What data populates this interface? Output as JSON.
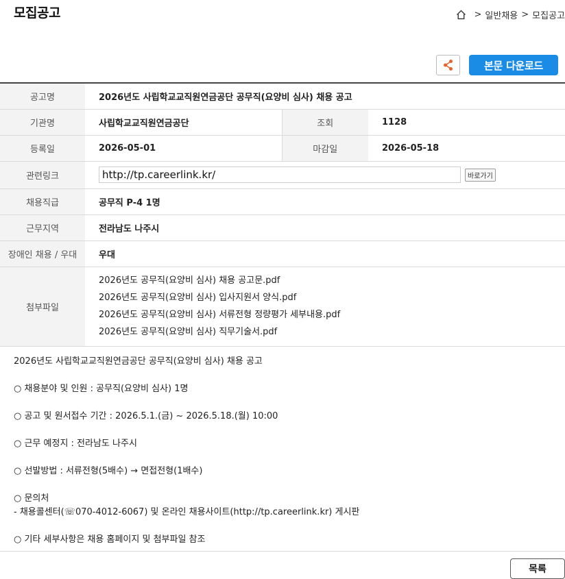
{
  "header": {
    "title": "모집공고",
    "breadcrumb": [
      ">",
      "일반채용",
      ">",
      "모집공고"
    ]
  },
  "actions": {
    "share_icon": "share-icon",
    "download_label": "본문 다운로드",
    "accent_color": "#1a8ce6"
  },
  "info": {
    "title_label": "공고명",
    "title_value": "2026년도 사립학교교직원연금공단 공무직(요양비 심사) 채용 공고",
    "org_label": "기관명",
    "org_value": "사립학교교직원연금공단",
    "views_label": "조회",
    "views_value": "1128",
    "reg_label": "등록일",
    "reg_value": "2026-05-01",
    "deadline_label": "마감일",
    "deadline_value": "2026-05-18",
    "link_label": "관련링크",
    "link_value": "http://tp.careerlink.kr/",
    "link_button": "바로가기",
    "grade_label": "채용직급",
    "grade_value": "공무직 P-4 1명",
    "region_label": "근무지역",
    "region_value": "전라남도 나주시",
    "disabled_label": "장애인 채용 / 우대",
    "disabled_value": "우대",
    "files_label": "첨부파일",
    "files": [
      "2026년도 공무직(요양비 심사) 채용 공고문.pdf",
      "2026년도 공무직(요양비 심사) 입사지원서 양식.pdf",
      "2026년도 공무직(요양비 심사) 서류전형 정량평가 세부내용.pdf",
      "2026년도 공무직(요양비 심사) 직무기술서.pdf"
    ]
  },
  "body": {
    "line1": "2026년도 사립학교교직원연금공단 공무직(요양비 심사) 채용 공고",
    "line2": "○ 채용분야 및 인원 : 공무직(요양비 심사) 1명",
    "line3": "○ 공고 및 원서접수 기간 : 2026.5.1.(금) ~ 2026.5.18.(월) 10:00",
    "line4": "○ 근무 예정지 : 전라남도 나주시",
    "line5": "○ 선발방법 : 서류전형(5배수) → 면접전형(1배수)",
    "line6": "○ 문의처",
    "line7": " - 채용콜센터(☏070-4012-6067) 및 온라인 채용사이트(http://tp.careerlink.kr) 게시판",
    "line8": "○ 기타 세부사항은 채용 홈페이지 및 첨부파일 참조"
  },
  "footer": {
    "list_button": "목록"
  }
}
